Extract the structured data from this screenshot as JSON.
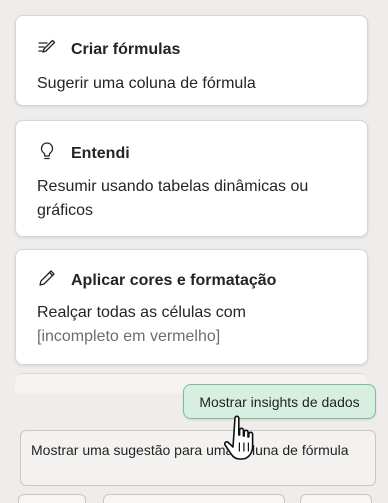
{
  "cards": [
    {
      "icon": "formula-pen-icon",
      "title": "Criar fórmulas",
      "body": "Sugerir uma coluna de fórmula"
    },
    {
      "icon": "lightbulb-icon",
      "title": "Entendi",
      "body": "Resumir usando tabelas dinâmicas ou gráficos"
    },
    {
      "icon": "pencil-icon",
      "title": "Aplicar cores e formatação",
      "body_line1": "Realçar todas as células com",
      "body_placeholder": "[incompleto em vermelho]"
    }
  ],
  "insights_button": {
    "label": "Mostrar insights de dados"
  },
  "suggestion": {
    "text": "Mostrar uma sugestão para uma coluna de fórmula"
  },
  "colors": {
    "accent_button_bg": "#d7efe1",
    "accent_button_border": "#7cbd95",
    "background": "#efedeb"
  }
}
